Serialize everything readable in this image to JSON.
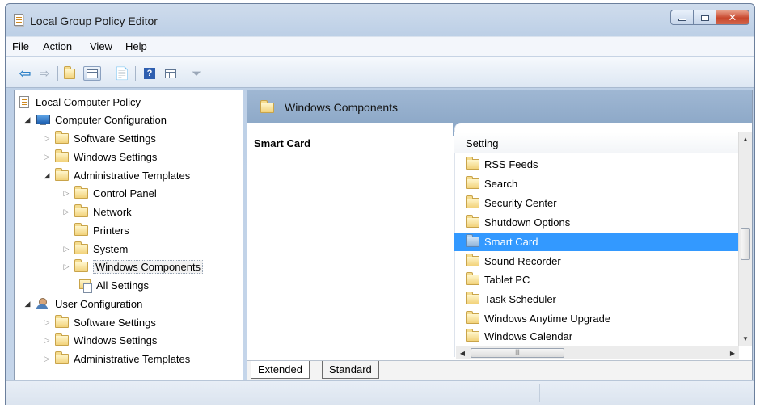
{
  "window": {
    "title": "Local Group Policy Editor"
  },
  "menu": [
    "File",
    "Action",
    "View",
    "Help"
  ],
  "tree": {
    "root": "Local Computer Policy",
    "computer_config": "Computer Configuration",
    "cc_software": "Software Settings",
    "cc_windows": "Windows Settings",
    "cc_admin": "Administrative Templates",
    "control_panel": "Control Panel",
    "network": "Network",
    "printers": "Printers",
    "system": "System",
    "windows_components": "Windows Components",
    "all_settings": "All Settings",
    "user_config": "User Configuration",
    "uc_software": "Software Settings",
    "uc_windows": "Windows Settings",
    "uc_admin": "Administrative Templates"
  },
  "right": {
    "header": "Windows Components",
    "desc_title": "Smart Card",
    "column_header": "Setting",
    "items": [
      "RSS Feeds",
      "Search",
      "Security Center",
      "Shutdown Options",
      "Smart Card",
      "Sound Recorder",
      "Tablet PC",
      "Task Scheduler",
      "Windows Anytime Upgrade",
      "Windows Calendar"
    ],
    "selected_item": "Smart Card"
  },
  "tabs": {
    "extended": "Extended",
    "standard": "Standard"
  }
}
